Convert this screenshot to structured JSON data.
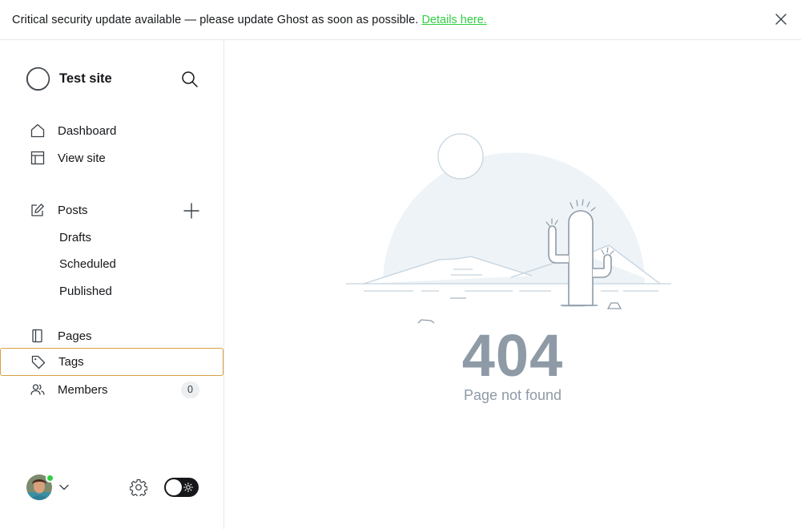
{
  "banner": {
    "message": "Critical security update available — please update Ghost as soon as possible.",
    "link_text": "Details here."
  },
  "sidebar": {
    "site_title": "Test site",
    "nav": [
      {
        "label": "Dashboard",
        "icon": "home-icon"
      },
      {
        "label": "View site",
        "icon": "layout-icon"
      }
    ],
    "posts": {
      "label": "Posts",
      "icon": "edit-icon",
      "sub_items": [
        "Drafts",
        "Scheduled",
        "Published"
      ]
    },
    "pages": {
      "label": "Pages",
      "icon": "page-icon"
    },
    "tags": {
      "label": "Tags",
      "icon": "tag-icon"
    },
    "members": {
      "label": "Members",
      "icon": "members-icon",
      "count": "0"
    }
  },
  "main": {
    "error_code": "404",
    "error_message": "Page not found"
  },
  "colors": {
    "accent_green": "#30cf43",
    "active_outline": "#d8a043",
    "muted_text": "#8e9aa6"
  }
}
